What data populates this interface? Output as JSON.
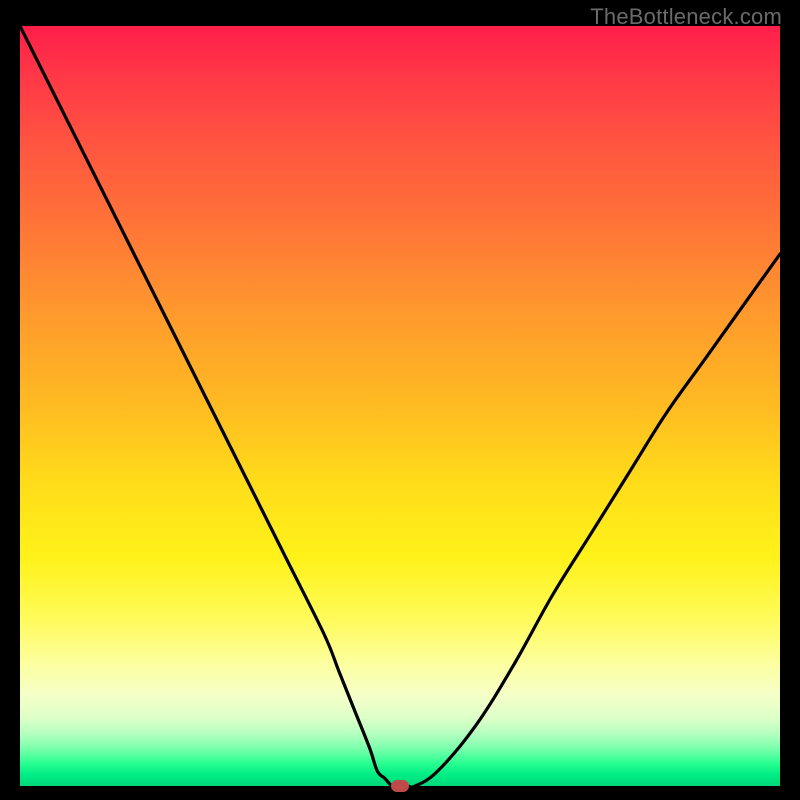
{
  "watermark": "TheBottleneck.com",
  "colors": {
    "frame": "#000000",
    "curve": "#000000",
    "marker": "#bf4a4a"
  },
  "chart_data": {
    "type": "line",
    "title": "",
    "xlabel": "",
    "ylabel": "",
    "xlim": [
      0,
      100
    ],
    "ylim": [
      0,
      100
    ],
    "grid": false,
    "series": [
      {
        "name": "curve",
        "x": [
          0,
          5,
          10,
          15,
          20,
          25,
          30,
          35,
          40,
          42,
          44,
          46,
          47,
          48,
          49,
          50,
          51,
          52,
          55,
          60,
          65,
          70,
          75,
          80,
          85,
          90,
          95,
          100
        ],
        "y": [
          100,
          90,
          80,
          70,
          60,
          50,
          40,
          30,
          20,
          15,
          10,
          5,
          2,
          1,
          0,
          0,
          0,
          0,
          2,
          8,
          16,
          25,
          33,
          41,
          49,
          56,
          63,
          70
        ]
      }
    ],
    "marker": {
      "x": 50,
      "y": 0
    },
    "gradient_stops": [
      {
        "pos": 0,
        "color": "#ff1e4a"
      },
      {
        "pos": 50,
        "color": "#ffbb22"
      },
      {
        "pos": 78,
        "color": "#fffb5a"
      },
      {
        "pos": 100,
        "color": "#00d87a"
      }
    ]
  }
}
